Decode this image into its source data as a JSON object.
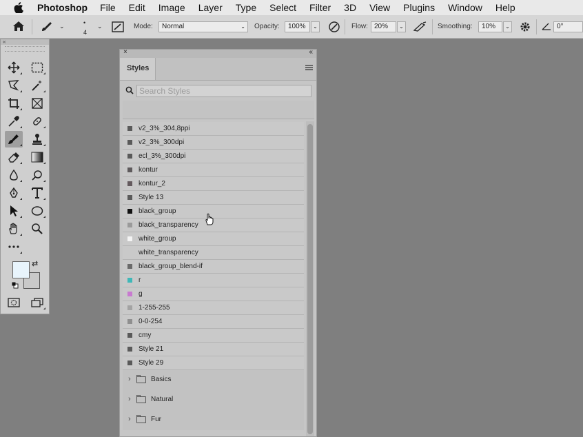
{
  "menubar": {
    "app_name": "Photoshop",
    "items": [
      "File",
      "Edit",
      "Image",
      "Layer",
      "Type",
      "Select",
      "Filter",
      "3D",
      "View",
      "Plugins",
      "Window",
      "Help"
    ]
  },
  "options": {
    "brush_size": "4",
    "mode_label": "Mode:",
    "mode_value": "Normal",
    "opacity_label": "Opacity:",
    "opacity_value": "100%",
    "flow_label": "Flow:",
    "flow_value": "20%",
    "smoothing_label": "Smoothing:",
    "smoothing_value": "10%",
    "angle_value": "0°"
  },
  "styles_panel": {
    "tab_label": "Styles",
    "search_placeholder": "Search Styles",
    "items": [
      {
        "name": "v2_3%_304,8ppi",
        "swatch": "#5a5a5a"
      },
      {
        "name": "v2_3%_300dpi",
        "swatch": "#5a5a5a"
      },
      {
        "name": "ecl_3%_300dpi",
        "swatch": "#5a5a5a"
      },
      {
        "name": "kontur",
        "swatch": "#5e5a5c"
      },
      {
        "name": "kontur_2",
        "swatch": "#645a5e"
      },
      {
        "name": "Style 13",
        "swatch": "#5a5a5a"
      },
      {
        "name": "black_group",
        "swatch": "#111111"
      },
      {
        "name": "black_transparency",
        "swatch": "#9a9a9a"
      },
      {
        "name": "white_group",
        "swatch": "#f4f4f4"
      },
      {
        "name": "white_transparency",
        "swatch": "#c9c9c9"
      },
      {
        "name": "black_group_blend-if",
        "swatch": "#6a6a6a"
      },
      {
        "name": "r",
        "swatch": "#3fb8b8"
      },
      {
        "name": "g",
        "swatch": "#c87ad0"
      },
      {
        "name": "1-255-255",
        "swatch": "#a3a3a3"
      },
      {
        "name": "0-0-254",
        "swatch": "#8f8f8f"
      },
      {
        "name": "cmy",
        "swatch": "#5a5a5a"
      },
      {
        "name": "Style 21",
        "swatch": "#5a5a5a"
      },
      {
        "name": "Style 29",
        "swatch": "#5a5a5a"
      }
    ],
    "groups": [
      "Basics",
      "Natural",
      "Fur"
    ]
  },
  "colors": {
    "foreground": "#e8f4fc",
    "background": "#c9c9c9"
  }
}
